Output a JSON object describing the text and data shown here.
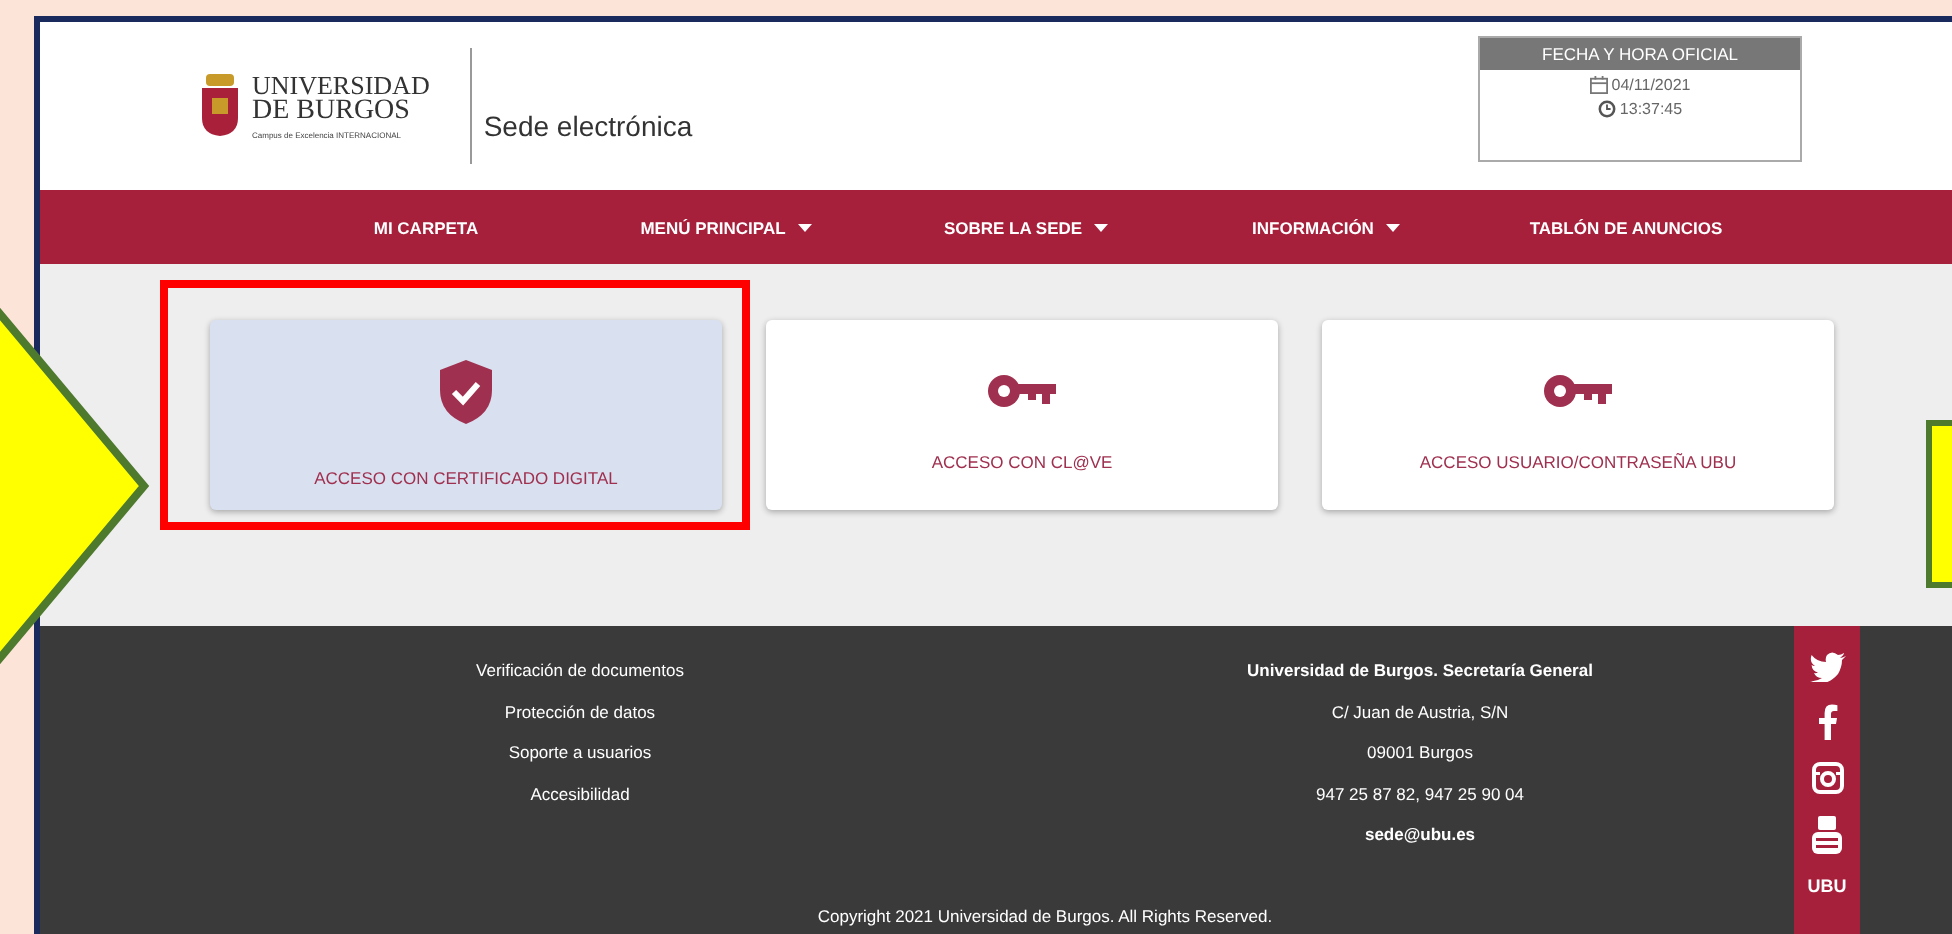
{
  "header": {
    "logo": {
      "line_1": "UNIVERSIDAD",
      "line_2": "DE BURGOS",
      "tagline": "Campus de Excelencia INTERNACIONAL"
    },
    "site_title": "Sede electrónica",
    "clock": {
      "title": "FECHA Y HORA OFICIAL",
      "date": "04/11/2021",
      "time": "13:37:45"
    }
  },
  "nav": [
    {
      "label": "MI CARPETA",
      "dropdown": false
    },
    {
      "label": "MENÚ PRINCIPAL",
      "dropdown": true
    },
    {
      "label": "SOBRE LA SEDE",
      "dropdown": true
    },
    {
      "label": "INFORMACIÓN",
      "dropdown": true
    },
    {
      "label": "TABLÓN DE ANUNCIOS",
      "dropdown": false
    }
  ],
  "cards": [
    {
      "label": "ACCESO CON CERTIFICADO DIGITAL",
      "kind": "shield",
      "selected": true
    },
    {
      "label": "ACCESO CON CL@VE",
      "kind": "key",
      "selected": false
    },
    {
      "label": "ACCESO USUARIO/CONTRASEÑA UBU",
      "kind": "key",
      "selected": false
    }
  ],
  "footer": {
    "links": [
      "Verificación de documentos",
      "Protección de datos",
      "Soporte a usuarios",
      "Accesibilidad"
    ],
    "contact": {
      "title": "Universidad de Burgos. Secretaría General",
      "lines": [
        "C/ Juan de Austria, S/N",
        "09001 Burgos",
        "947 25 87 82, 947 25 90 04"
      ],
      "email": "sede@ubu.es"
    },
    "social": [
      {
        "kind": "twitter"
      },
      {
        "kind": "facebook"
      },
      {
        "kind": "instagram"
      },
      {
        "kind": "youtube"
      },
      {
        "kind": "app",
        "label": "UBU"
      }
    ],
    "copyright": "Copyright 2021 Universidad de Burgos. All Rights Reserved."
  }
}
